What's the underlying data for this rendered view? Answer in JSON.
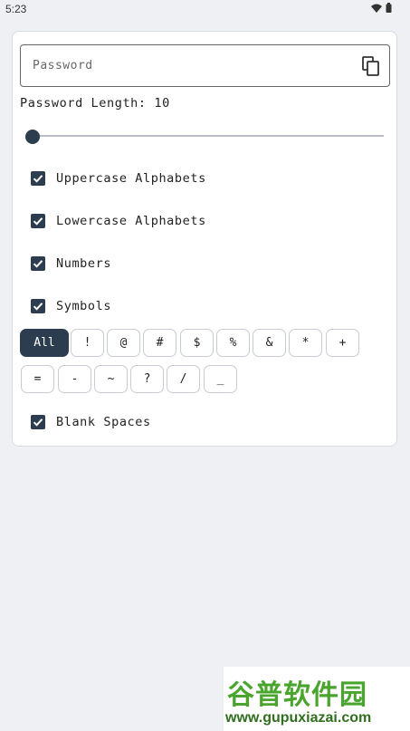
{
  "status": {
    "time": "5:23"
  },
  "password": {
    "placeholder": "Password"
  },
  "length": {
    "label": "Password Length: 10",
    "value": 10
  },
  "options": [
    {
      "label": "Uppercase Alphabets",
      "checked": true
    },
    {
      "label": "Lowercase Alphabets",
      "checked": true
    },
    {
      "label": "Numbers",
      "checked": true
    },
    {
      "label": "Symbols",
      "checked": true
    },
    {
      "label": "Blank Spaces",
      "checked": true
    }
  ],
  "symbols": [
    "All",
    "!",
    "@",
    "#",
    "$",
    "%",
    "&",
    "*",
    "+",
    "=",
    "-",
    "~",
    "?",
    "/",
    "_"
  ],
  "selected_symbol": "All",
  "watermark": {
    "brand": "谷普软件园",
    "url": "www.gupuxiazai.com"
  },
  "colors": {
    "accent": "#2b3d4f",
    "background": "#eef0f3",
    "watermark_green": "#4aa52e"
  }
}
